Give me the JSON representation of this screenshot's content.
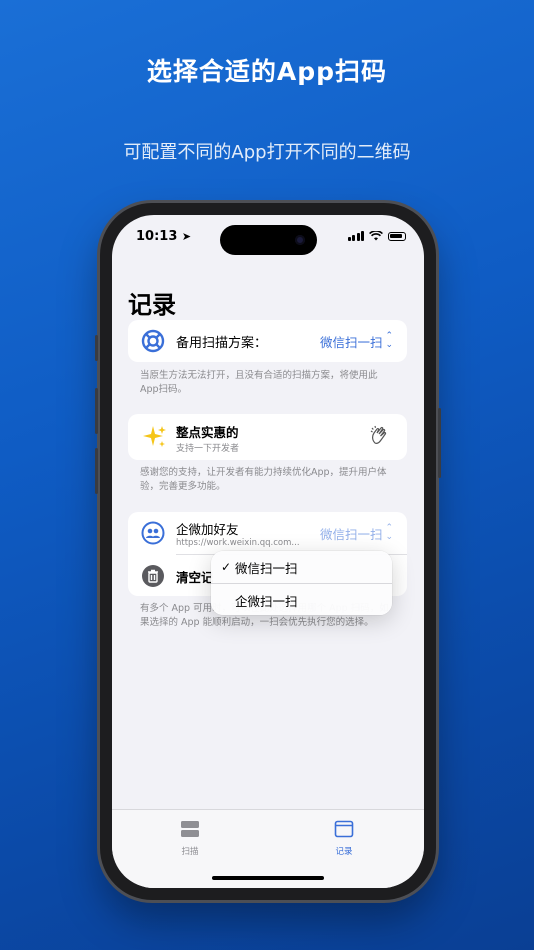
{
  "promo": {
    "headline": "选择合适的App扫码",
    "subline": "可配置不同的App打开不同的二维码"
  },
  "status_bar": {
    "time": "10:13"
  },
  "page": {
    "title": "记录"
  },
  "backup_card": {
    "label": "备用扫描方案：",
    "value": "微信扫一扫",
    "note": "当原生方法无法打开，且没有合适的扫描方案，将使用此App扫码。"
  },
  "support_card": {
    "title": "整点实惠的",
    "subtitle": "支持一下开发者",
    "note": "感谢您的支持，让开发者有能力持续优化App，提升用户体验，完善更多功能。"
  },
  "record_card": {
    "item_title": "企微加好友",
    "item_url": "https://work.weixin.qq.com...",
    "item_value": "微信扫一扫",
    "clear_label": "清空记",
    "note": "有多个 App 可用时，可以在此处选择用哪个 App 扫码，如果选择的 App 能顺利启动，一扫会优先执行您的选择。"
  },
  "popup_menu": {
    "items": [
      {
        "label": "微信扫一扫",
        "selected": true
      },
      {
        "label": "企微扫一扫",
        "selected": false
      }
    ]
  },
  "tabbar": {
    "scan_label": "扫描",
    "records_label": "记录"
  },
  "colors": {
    "accent": "#3a6fd8",
    "background": "#0f5cc4"
  }
}
